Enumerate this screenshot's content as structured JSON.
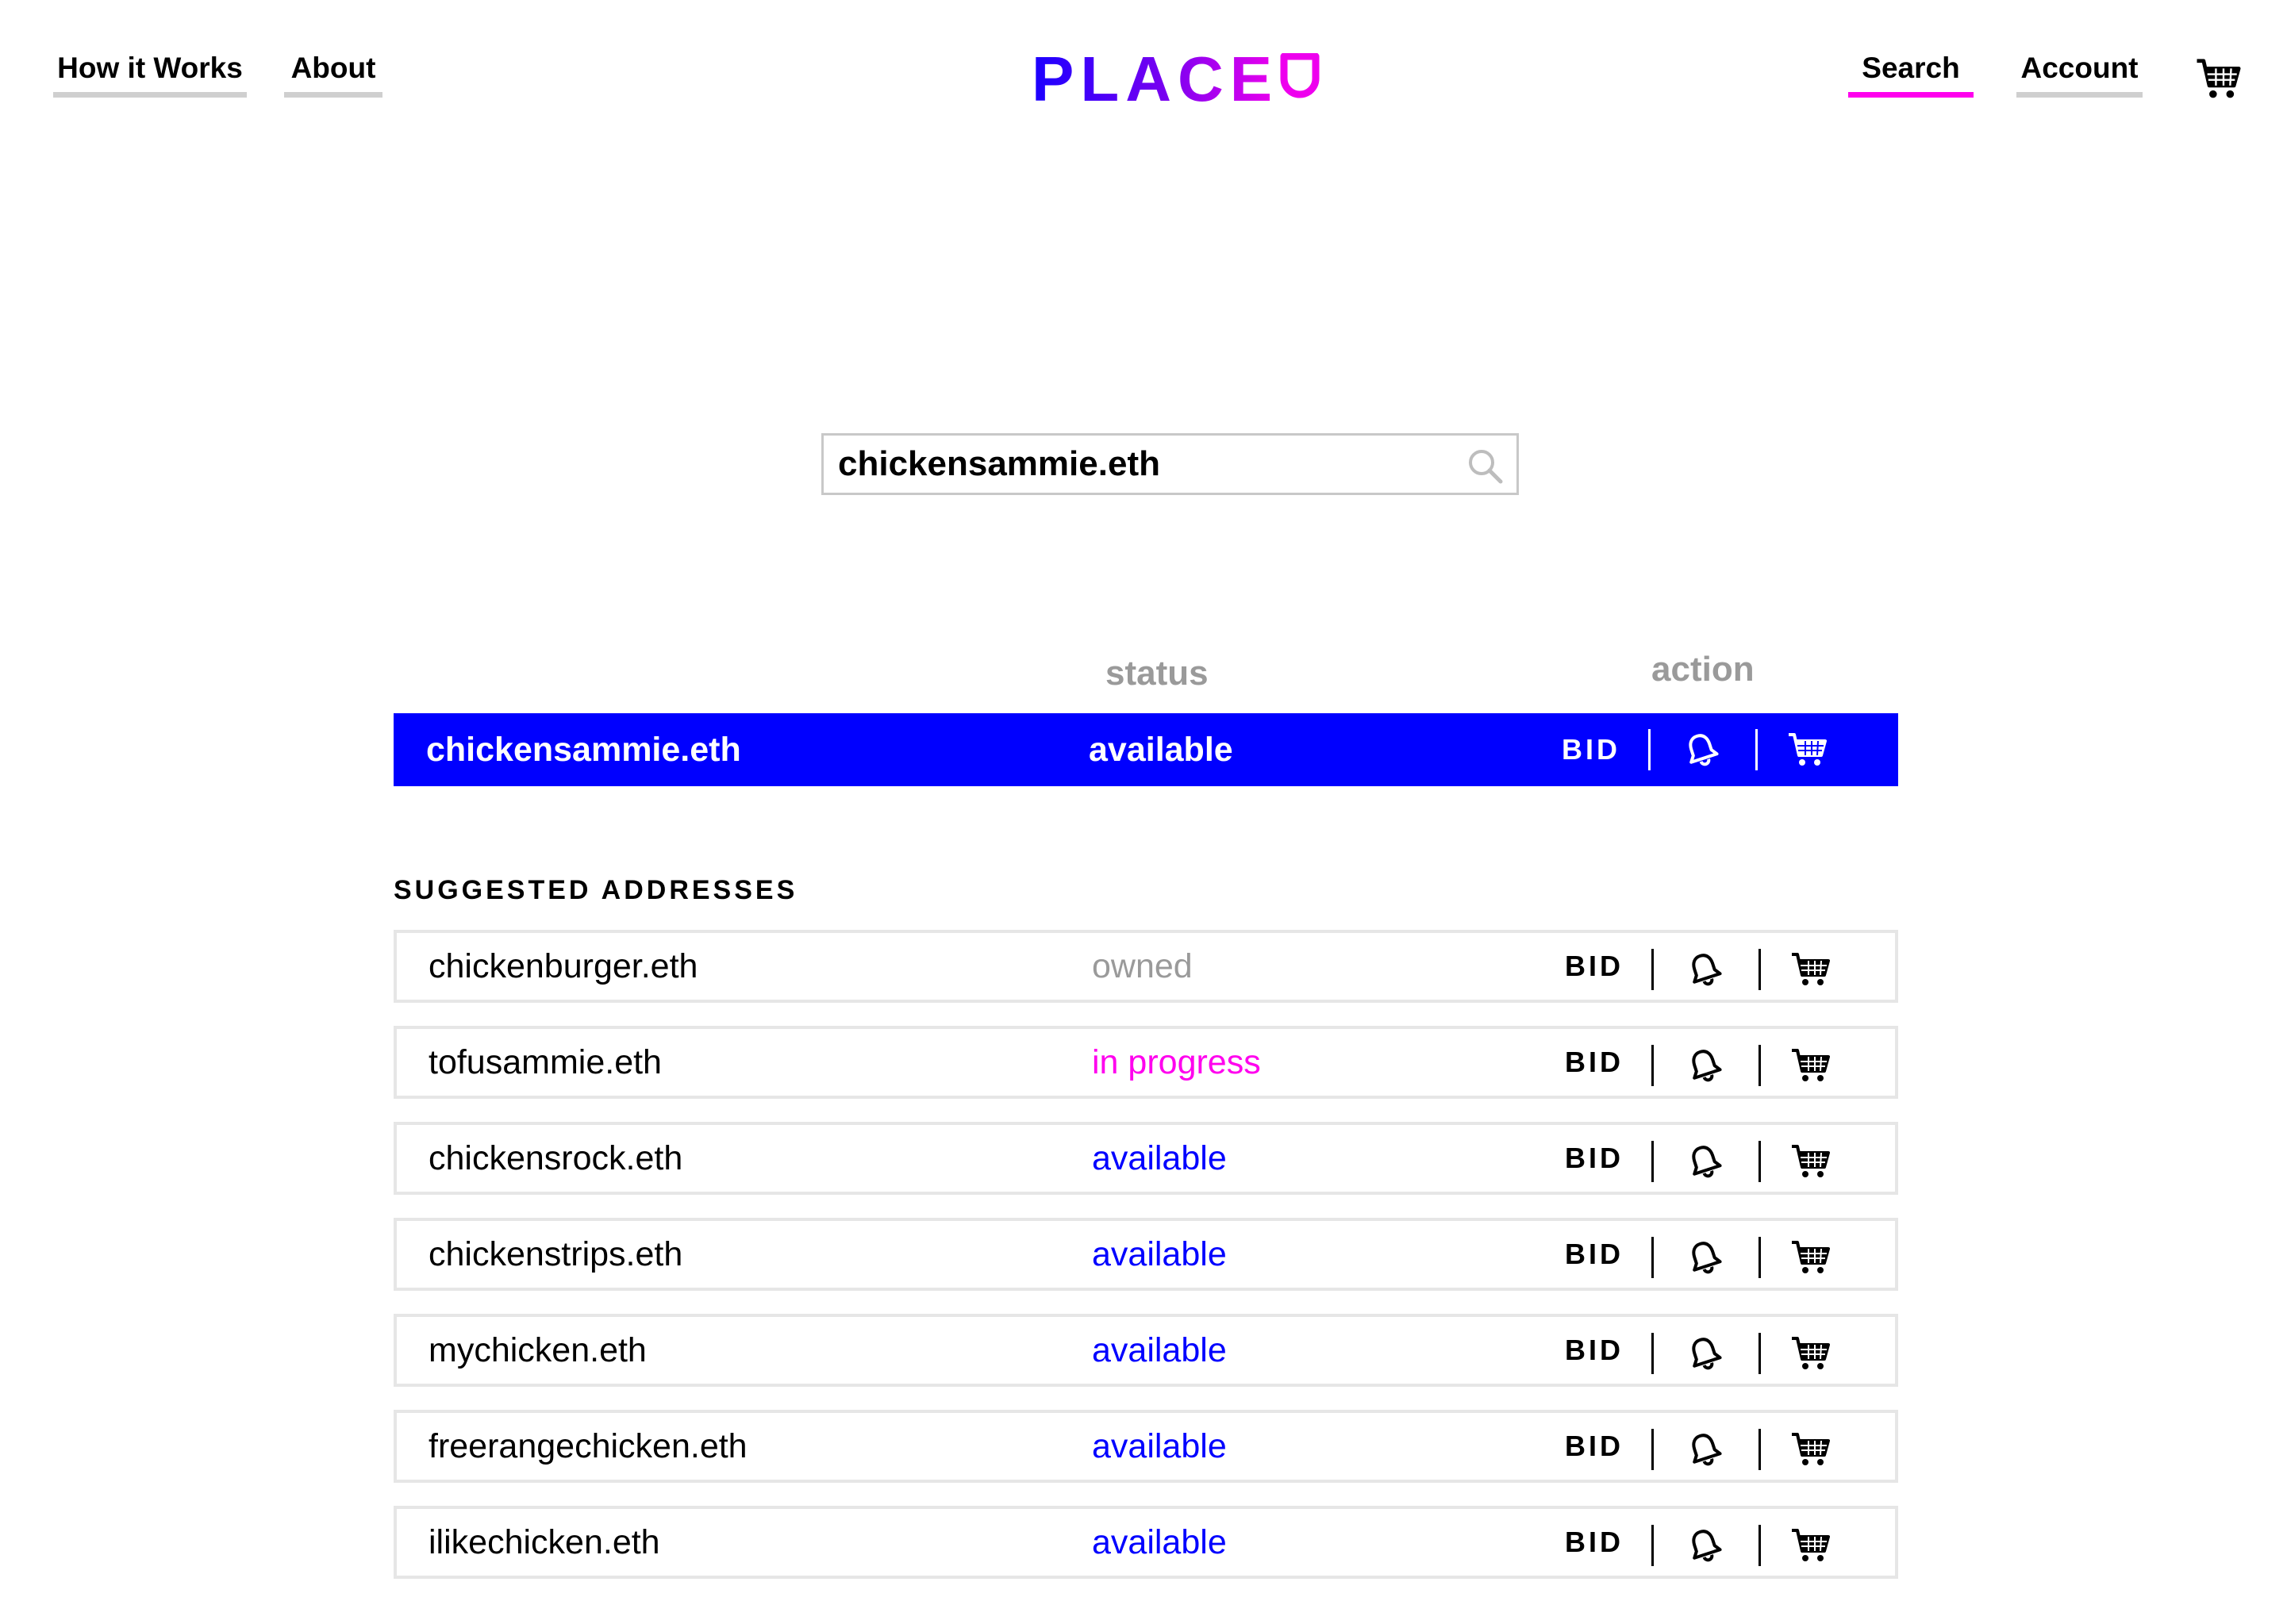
{
  "nav": {
    "how_it_works": "How it Works",
    "about": "About",
    "search": "Search",
    "account": "Account",
    "logo_text": "PLACE"
  },
  "search": {
    "value": "chickensammie.eth",
    "placeholder": ""
  },
  "columns": {
    "status": "status",
    "action": "action"
  },
  "featured": {
    "name": "chickensammie.eth",
    "status": "available",
    "bid_label": "BID"
  },
  "suggested": {
    "title": "SUGGESTED ADDRESSES",
    "items": [
      {
        "name": "chickenburger.eth",
        "status": "owned",
        "bid_label": "BID"
      },
      {
        "name": "tofusammie.eth",
        "status": "in progress",
        "bid_label": "BID"
      },
      {
        "name": "chickensrock.eth",
        "status": "available",
        "bid_label": "BID"
      },
      {
        "name": "chickenstrips.eth",
        "status": "available",
        "bid_label": "BID"
      },
      {
        "name": "mychicken.eth",
        "status": "available",
        "bid_label": "BID"
      },
      {
        "name": "freerangechicken.eth",
        "status": "available",
        "bid_label": "BID"
      },
      {
        "name": "ilikechicken.eth",
        "status": "available",
        "bid_label": "BID"
      }
    ]
  },
  "colors": {
    "accent_blue": "#0000ff",
    "accent_magenta": "#ff00ee",
    "status_owned": "#9a9a9a",
    "status_in_progress": "#ff00ee",
    "status_available": "#0000ff"
  },
  "icons": {
    "search": "search-icon",
    "bell": "bell-icon",
    "cart": "cart-icon"
  }
}
